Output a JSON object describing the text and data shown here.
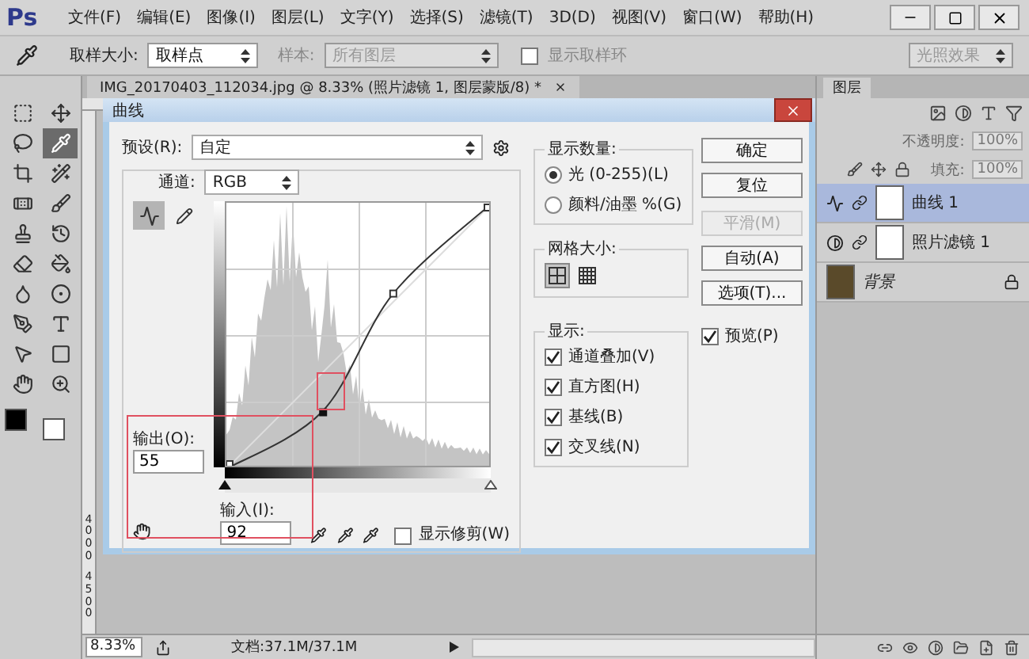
{
  "app": {
    "logo": "Ps",
    "menu": [
      "文件(F)",
      "编辑(E)",
      "图像(I)",
      "图层(L)",
      "文字(Y)",
      "选择(S)",
      "滤镜(T)",
      "3D(D)",
      "视图(V)",
      "窗口(W)",
      "帮助(H)"
    ]
  },
  "options_bar": {
    "sample_size_label": "取样大小:",
    "sample_size": "取样点",
    "sample_label": "样本:",
    "sample": "所有图层",
    "show_ring": {
      "label": "显示取样环",
      "checked": false
    },
    "workspace": "光照效果"
  },
  "tools": [
    {
      "kind": "marquee",
      "selected": false
    },
    {
      "kind": "move",
      "selected": false
    },
    {
      "kind": "lasso",
      "selected": false
    },
    {
      "kind": "eyedropper",
      "selected": true
    },
    {
      "kind": "crop",
      "selected": false
    },
    {
      "kind": "wand",
      "selected": false
    },
    {
      "kind": "healing",
      "selected": false
    },
    {
      "kind": "brush",
      "selected": false
    },
    {
      "kind": "stamp",
      "selected": false
    },
    {
      "kind": "history",
      "selected": false
    },
    {
      "kind": "eraser",
      "selected": false
    },
    {
      "kind": "gradient",
      "selected": false
    },
    {
      "kind": "blur",
      "selected": false
    },
    {
      "kind": "dodge",
      "selected": false
    },
    {
      "kind": "pen",
      "selected": false
    },
    {
      "kind": "type",
      "selected": false
    },
    {
      "kind": "select",
      "selected": false
    },
    {
      "kind": "shape",
      "selected": false
    },
    {
      "kind": "hand",
      "selected": false
    },
    {
      "kind": "zoom",
      "selected": false
    }
  ],
  "document": {
    "tab": "IMG_20170403_112034.jpg @ 8.33% (照片滤镜 1, 图层蒙版/8) *",
    "ruler_labels": [
      "4000",
      "4500"
    ],
    "zoom": "8.33%",
    "doc_size": "文档:37.1M/37.1M"
  },
  "dialog": {
    "title": "曲线",
    "preset_label": "预设(R):",
    "preset": "自定",
    "channel_label": "通道:",
    "channel": "RGB",
    "sliders": [
      {
        "kind": "shadow",
        "level": 0
      },
      {
        "kind": "highlight",
        "level": 1
      }
    ],
    "output_label": "输出(O):",
    "output": "55",
    "input_label": "输入(I):",
    "input": "92",
    "show_clipping": {
      "label": "显示修剪(W)",
      "checked": false
    },
    "display_amount": {
      "title": "显示数量:",
      "options": [
        {
          "label": "光 (0-255)(L)",
          "selected": true
        },
        {
          "label": "颜料/油墨 %(G)",
          "selected": false
        }
      ]
    },
    "grid_size": {
      "title": "网格大小:",
      "options": [
        {
          "kind": "coarse",
          "selected": true
        },
        {
          "kind": "fine",
          "selected": false
        }
      ]
    },
    "show": {
      "title": "显示:",
      "options": [
        {
          "label": "通道叠加(V)",
          "checked": true
        },
        {
          "label": "直方图(H)",
          "checked": true
        },
        {
          "label": "基线(B)",
          "checked": true
        },
        {
          "label": "交叉线(N)",
          "checked": true
        }
      ]
    },
    "buttons": [
      {
        "label": "确定",
        "disabled": false
      },
      {
        "label": "复位",
        "disabled": false
      },
      {
        "label": "平滑(M)",
        "disabled": true
      },
      {
        "label": "自动(A)",
        "disabled": false
      },
      {
        "label": "选项(T)...",
        "disabled": false
      }
    ],
    "preview": {
      "label": "预览(P)",
      "checked": true
    }
  },
  "layers_panel": {
    "tab": "图层",
    "opacity_label": "不透明度:",
    "opacity": "100%",
    "fill_label": "填充:",
    "fill": "100%",
    "layers": [
      {
        "name": "曲线 1",
        "kind": "curves",
        "selected": true
      },
      {
        "name": "照片滤镜 1",
        "kind": "filter",
        "selected": false
      },
      {
        "name": "背景",
        "kind": "background",
        "selected": false
      }
    ]
  }
}
